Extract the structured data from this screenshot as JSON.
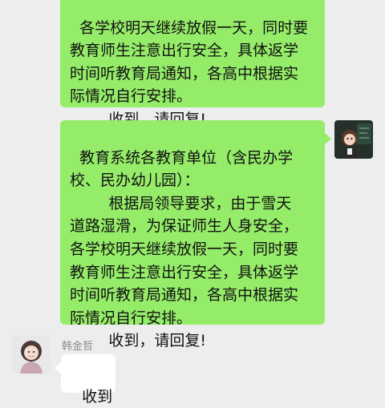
{
  "messages": [
    {
      "id": "msg1",
      "side": "right",
      "text": "各学校明天继续放假一天，同时要\n教育师生注意出行安全，具体返学\n时间听教育局通知，各高中根据实\n际情况自行安排。\n        收到，请回复!"
    },
    {
      "id": "msg2",
      "side": "right",
      "text": "教育系统各教育单位（含民办学\n校、民办幼儿园）：\n        根据局领导要求，由于雪天\n道路湿滑，为保证师生人身安全，\n各学校明天继续放假一天，同时要\n教育师生注意出行安全，具体返学\n时间听教育局通知，各高中根据实\n际情况自行安排。\n        收到，请回复!"
    },
    {
      "id": "msg3",
      "side": "left",
      "sender": "韩金哲",
      "text": "收到"
    }
  ],
  "colors": {
    "chat_background": "#ededed",
    "outgoing_bubble": "#95ec69",
    "incoming_bubble": "#ffffff",
    "sender_name": "#8a8a8a"
  }
}
